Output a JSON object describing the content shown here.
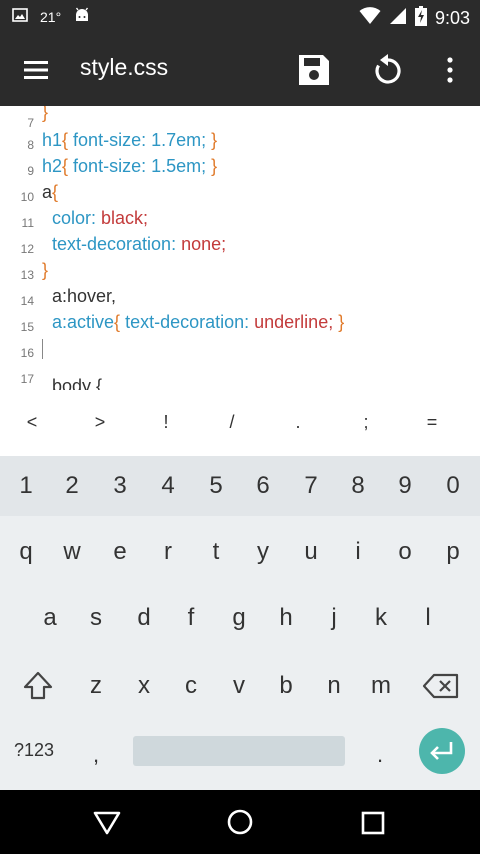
{
  "status": {
    "temperature": "21°",
    "time": "9:03"
  },
  "appbar": {
    "title": "style.css"
  },
  "editor": {
    "lines": [
      {
        "num": "7"
      },
      {
        "num": "8",
        "selector": "h1",
        "open": "{",
        "prop": " font-size:",
        "val": " 1.7em;",
        "close": " }"
      },
      {
        "num": "9",
        "selector": "h2",
        "open": "{",
        "prop": " font-size:",
        "val": " 1.5em;",
        "close": " }"
      },
      {
        "num": "10",
        "selector": "a",
        "open": "{"
      },
      {
        "num": "11",
        "prop": "  color:",
        "val": " black;"
      },
      {
        "num": "12",
        "prop": "  text-decoration:",
        "val": " none;"
      },
      {
        "num": "13",
        "close": "}"
      },
      {
        "num": "14",
        "selector": "  a:hover,"
      },
      {
        "num": "15",
        "selector": "  a:active",
        "open": "{",
        "prop": " text-decoration:",
        "val": " underline;",
        "close": " }"
      },
      {
        "num": "16"
      },
      {
        "num": "17"
      }
    ],
    "line7_close": "}",
    "partial_next": "  body {"
  },
  "symbols": [
    "<",
    ">",
    "!",
    "/",
    ".",
    ";",
    "="
  ],
  "keyboard": {
    "numbers": [
      "1",
      "2",
      "3",
      "4",
      "5",
      "6",
      "7",
      "8",
      "9",
      "0"
    ],
    "row1": [
      "q",
      "w",
      "e",
      "r",
      "t",
      "y",
      "u",
      "i",
      "o",
      "p"
    ],
    "row2": [
      "a",
      "s",
      "d",
      "f",
      "g",
      "h",
      "j",
      "k",
      "l"
    ],
    "row3": [
      "z",
      "x",
      "c",
      "v",
      "b",
      "n",
      "m"
    ],
    "bottom": {
      "mode": "?123",
      "comma": ",",
      "period": "."
    }
  },
  "colors": {
    "bar": "#2b2b2b",
    "selector": "#2d96c4",
    "value": "#c33b3b",
    "brace": "#e07a2a",
    "enter": "#4db6ac"
  },
  "icons": [
    "image-icon",
    "android-icon",
    "wifi-icon",
    "signal-icon",
    "battery-charging-icon",
    "menu-icon",
    "save-icon",
    "refresh-icon",
    "more-vert-icon",
    "shift-icon",
    "backspace-icon",
    "enter-icon",
    "back-icon",
    "home-icon",
    "recents-icon"
  ]
}
